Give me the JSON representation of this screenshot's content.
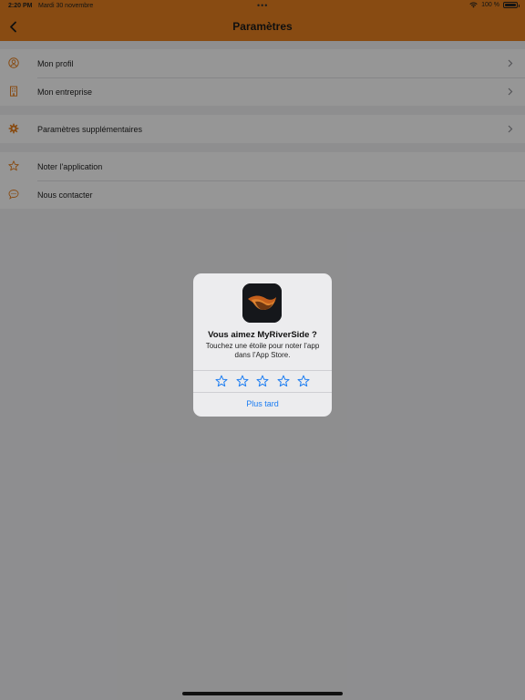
{
  "status_bar": {
    "time": "2:20 PM",
    "date": "Mardi 30 novembre",
    "battery": "100 %",
    "icons": [
      "wifi-icon",
      "battery-icon"
    ]
  },
  "nav": {
    "title": "Paramètres",
    "back_icon": "chevron-left-icon"
  },
  "settings": {
    "groups": [
      {
        "items": [
          {
            "label": "Mon profil",
            "icon": "user-circle-icon",
            "chevron": true
          },
          {
            "label": "Mon entreprise",
            "icon": "building-icon",
            "chevron": true
          }
        ]
      },
      {
        "items": [
          {
            "label": "Paramètres supplémentaires",
            "icon": "gear-icon",
            "chevron": true
          }
        ]
      },
      {
        "items": [
          {
            "label": "Noter l'application",
            "icon": "star-outline-icon",
            "chevron": false
          },
          {
            "label": "Nous contacter",
            "icon": "chat-bubble-icon",
            "chevron": false
          }
        ]
      }
    ]
  },
  "rating_dialog": {
    "title": "Vous aimez MyRiverSide ?",
    "message": "Touchez une étoile pour noter l’app dans l’App Store.",
    "star_count": 5,
    "rating": 0,
    "later_label": "Plus tard"
  },
  "colors": {
    "accent": "#e7801f",
    "link": "#1a7cf2"
  }
}
